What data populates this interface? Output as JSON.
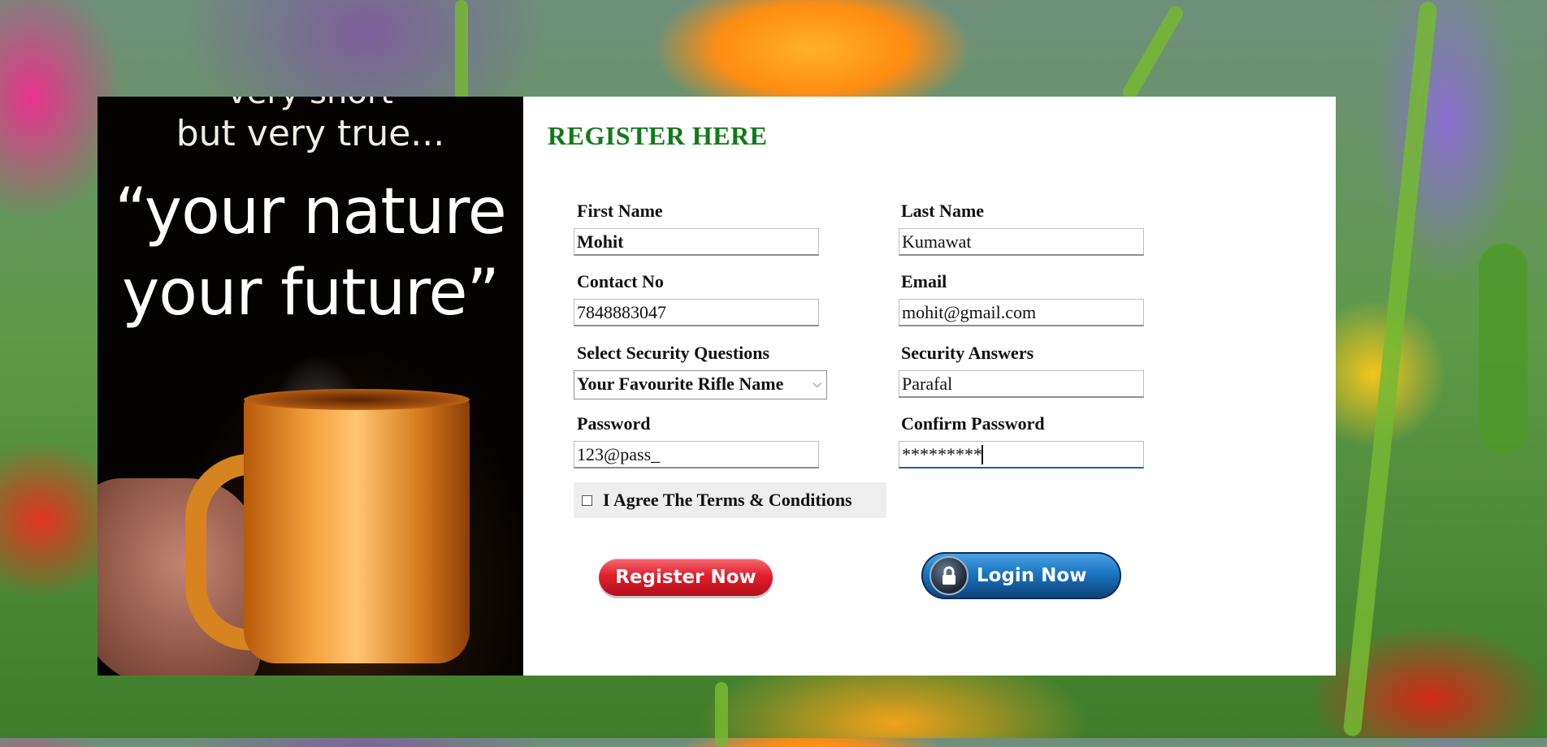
{
  "poster": {
    "line1": "very short",
    "line2": "but very true...",
    "quote_line1": "“your nature",
    "quote_line2": "your future”"
  },
  "form": {
    "title": "REGISTER HERE",
    "first_name": {
      "label": "First Name",
      "value": "Mohit"
    },
    "last_name": {
      "label": "Last Name",
      "value": "Kumawat"
    },
    "contact": {
      "label": "Contact No",
      "value": "7848883047"
    },
    "email": {
      "label": "Email",
      "value": "mohit@gmail.com"
    },
    "security_question": {
      "label": "Select Security Questions",
      "selected": "Your Favourite Rifle Name"
    },
    "security_answer": {
      "label": "Security Answers",
      "value": "Parafal"
    },
    "password": {
      "label": "Password",
      "value": "123@pass_"
    },
    "confirm_password": {
      "label": "Confirm Password",
      "value": "*********"
    },
    "terms": {
      "label": "I Agree The Terms & Conditions",
      "checked": false
    },
    "register_button": "Register Now",
    "login_button": "Login Now"
  },
  "colors": {
    "title": "#0f7a1a",
    "register_button": "#e21f2c",
    "login_button": "#1a76c2"
  },
  "icons": {
    "select_arrow": "chevron-down-icon",
    "login": "lock-icon"
  }
}
